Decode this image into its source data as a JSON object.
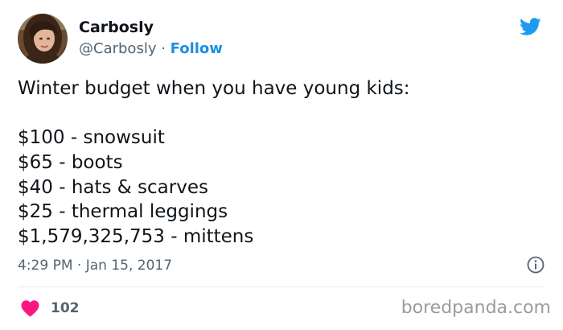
{
  "author": {
    "name": "Carbosly",
    "handle": "@Carbosly",
    "separator": " · ",
    "follow_label": "Follow",
    "avatar_icon": "profile-photo"
  },
  "header": {
    "platform_icon": "twitter-bird-icon"
  },
  "tweet": {
    "lines": [
      "Winter budget when you have young kids:",
      "",
      "$100 - snowsuit",
      "$65 - boots",
      "$40 - hats & scarves",
      "$25 - thermal leggings",
      "$1,579,325,753 - mittens"
    ]
  },
  "meta": {
    "timestamp": "4:29 PM · Jan 15, 2017",
    "info_icon": "info-icon"
  },
  "actions": {
    "like_count": "102",
    "like_icon": "heart-icon"
  },
  "watermark": {
    "text": "boredpanda.com"
  },
  "colors": {
    "follow_blue": "#1b8fe3",
    "twitter_blue": "#1d9bf0",
    "heart_pink": "#f91880",
    "secondary_text": "#536471",
    "watermark_gray": "#9b9b9b"
  }
}
